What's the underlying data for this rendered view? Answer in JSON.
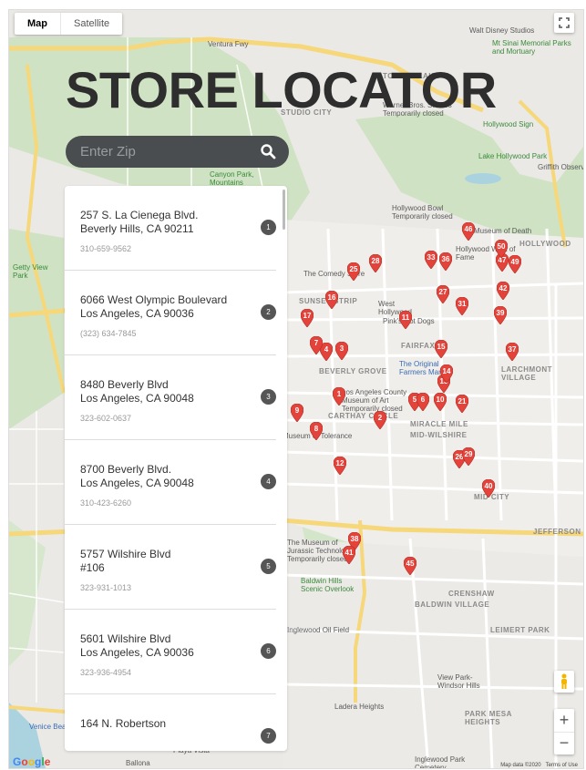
{
  "map_type": {
    "map": "Map",
    "satellite": "Satellite",
    "selected": "Map"
  },
  "title": "STORE LOCATOR",
  "search": {
    "placeholder": "Enter Zip",
    "value": ""
  },
  "stores": [
    {
      "number": "1",
      "line1": "257 S. La Cienega Blvd.",
      "line2": "Beverly Hills, CA 90211",
      "phone": "310-659-9562"
    },
    {
      "number": "2",
      "line1": "6066 West Olympic Boulevard",
      "line2": "Los Angeles, CA 90036",
      "phone": "(323) 634-7845"
    },
    {
      "number": "3",
      "line1": "8480 Beverly Blvd",
      "line2": "Los Angeles, CA 90048",
      "phone": "323-602-0637"
    },
    {
      "number": "4",
      "line1": "8700 Beverly Blvd.",
      "line2": "Los Angeles, CA 90048",
      "phone": "310-423-6260"
    },
    {
      "number": "5",
      "line1": "5757 Wilshire Blvd",
      "line2": "#106",
      "phone": "323-931-1013"
    },
    {
      "number": "6",
      "line1": "5601 Wilshire Blvd",
      "line2": "Los Angeles, CA 90036",
      "phone": "323-936-4954"
    },
    {
      "number": "7",
      "line1": "164 N. Robertson",
      "line2": "",
      "phone": ""
    }
  ],
  "markers": [
    "1",
    "2",
    "3",
    "4",
    "5",
    "6",
    "7",
    "8",
    "9",
    "10",
    "11",
    "12",
    "13",
    "14",
    "15",
    "16",
    "17",
    "21",
    "25",
    "26",
    "27",
    "28",
    "29",
    "31",
    "33",
    "36",
    "37",
    "38",
    "39",
    "40",
    "41",
    "42",
    "45",
    "46",
    "47",
    "49",
    "50"
  ],
  "place_labels": {
    "walt_disney": "Walt Disney Studios",
    "mt_sinai": "Mt Sinai Memorial Parks and Mortuary",
    "toluca_lake": "TOLUCA LAKE",
    "ventura_fwy": "Ventura Fwy",
    "studio_city": "STUDIO CITY",
    "warner": "Warner Bros. Studios Temporarily closed",
    "hollywood_sign": "Hollywood Sign",
    "lake_hollywood": "Lake Hollywood Park",
    "griffith": "Griffith Observ",
    "canyon_park": "Canyon Park, Mountains",
    "hollywood_bowl": "Hollywood Bowl Temporarily closed",
    "museum_death": "Museum of Death",
    "walk_fame": "Hollywood Walk of Fame",
    "hollywood": "HOLLYWOOD",
    "comedy_store": "The Comedy Store",
    "west_hollywood": "West Hollywood",
    "pinks": "Pink's Hot Dogs",
    "sunset_strip": "SUNSET STRIP",
    "fairfax": "FAIRFAX",
    "farmers_market": "The Original Farmers Market",
    "beverly_grove": "BEVERLY GROVE",
    "larchmont": "LARCHMONT VILLAGE",
    "lacma": "Los Angeles County Museum of Art Temporarily closed",
    "carthay": "CARTHAY CIRCLE",
    "miracle": "MIRACLE MILE",
    "mid_wilshire": "MID-WILSHIRE",
    "tolerance": "Museum of Tolerance",
    "mid_city": "MID CITY",
    "jefferson": "JEFFERSON",
    "jurassic": "The Museum of Jurassic Technology Temporarily closed",
    "crenshaw": "CRENSHAW",
    "baldwin_village": "BALDWIN VILLAGE",
    "baldwin_hills": "Baldwin Hills Scenic Overlook",
    "leimert": "LEIMERT PARK",
    "inglewood_oil": "Inglewood Oil Field",
    "view_park": "View Park-Windsor Hills",
    "ladera": "Ladera Heights",
    "park_mesa": "PARK MESA HEIGHTS",
    "getty": "Getty View Park",
    "venice_beach": "Venice Beach",
    "playa_vista": "Playa Vista",
    "ballona": "Ballona",
    "inglewood_cemetery": "Inglewood Park Cemetery"
  },
  "footer": {
    "logo": "Google",
    "map_data": "Map data ©2020",
    "terms": "Terms of Use"
  },
  "colors": {
    "accent": "#4a4d50",
    "marker": "#e3433a",
    "list_number": "#555555"
  }
}
